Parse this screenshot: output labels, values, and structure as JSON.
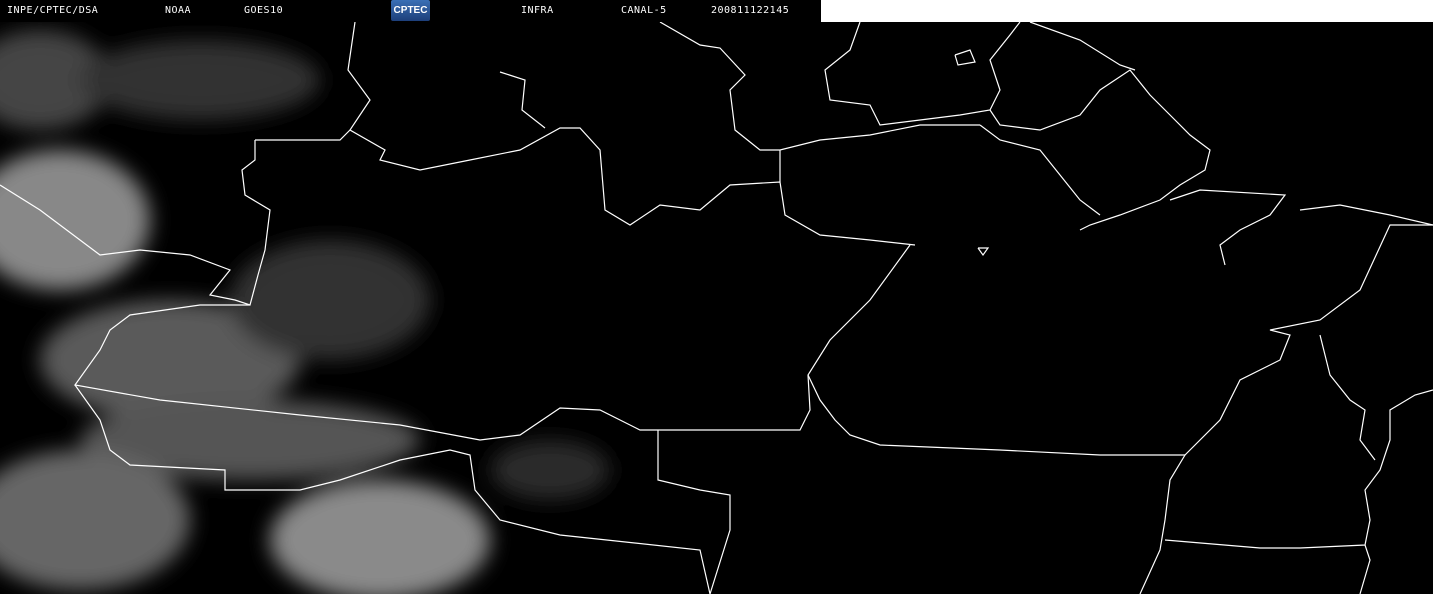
{
  "header": {
    "institution": "INPE/CPTEC/DSA",
    "agency": "NOAA",
    "satellite": "GOES10",
    "logo_text": "CPTEC",
    "band": "INFRA",
    "channel": "CANAL-5",
    "timestamp": "200811122145"
  },
  "colors": {
    "background": "#000000",
    "borders": "#ffffff",
    "clouds": "#8a8a8a"
  }
}
